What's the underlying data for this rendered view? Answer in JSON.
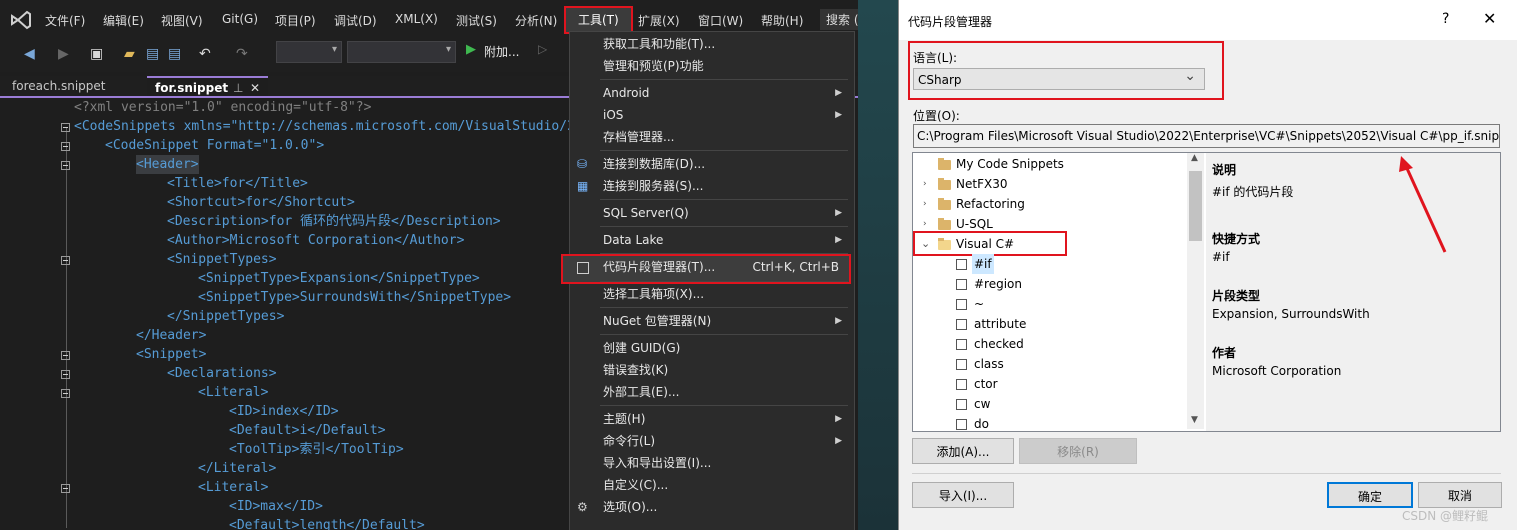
{
  "vs": {
    "menu": [
      "文件(F)",
      "编辑(E)",
      "视图(V)",
      "Git(G)",
      "项目(P)",
      "调试(D)",
      "XML(X)",
      "测试(S)",
      "分析(N)",
      "工具(T)",
      "扩展(X)",
      "窗口(W)",
      "帮助(H)",
      "搜索 ("
    ],
    "toolbar_run_label": "附加...",
    "tabs": [
      "foreach.snippet",
      "for.snippet"
    ],
    "code": [
      "<?xml version=\"1.0\" encoding=\"utf-8\"?>",
      "<CodeSnippets xmlns=\"http://schemas.microsoft.com/VisualStudio/2",
      "<CodeSnippet Format=\"1.0.0\">",
      "<Header>",
      "<Title>for</Title>",
      "<Shortcut>for</Shortcut>",
      "<Description>for 循环的代码片段</Description>",
      "<Author>Microsoft Corporation</Author>",
      "<SnippetTypes>",
      "<SnippetType>Expansion</SnippetType>",
      "<SnippetType>SurroundsWith</SnippetType>",
      "</SnippetTypes>",
      "</Header>",
      "<Snippet>",
      "<Declarations>",
      "<Literal>",
      "<ID>index</ID>",
      "<Default>i</Default>",
      "<ToolTip>索引</ToolTip>",
      "</Literal>",
      "<Literal>",
      "<ID>max</ID>",
      "<Default>length</Default>"
    ],
    "tools_menu": {
      "items": [
        {
          "label": "获取工具和功能(T)...",
          "arrow": false,
          "icon": ""
        },
        {
          "label": "管理和预览(P)功能",
          "arrow": false,
          "icon": ""
        },
        {
          "label": "Android",
          "arrow": true,
          "icon": ""
        },
        {
          "label": "iOS",
          "arrow": true,
          "icon": ""
        },
        {
          "label": "存档管理器...",
          "arrow": false,
          "icon": ""
        },
        {
          "label": "连接到数据库(D)...",
          "arrow": false,
          "icon": "database-connect-icon"
        },
        {
          "label": "连接到服务器(S)...",
          "arrow": false,
          "icon": "server-connect-icon"
        },
        {
          "label": "SQL Server(Q)",
          "arrow": true,
          "icon": ""
        },
        {
          "label": "Data Lake",
          "arrow": true,
          "icon": ""
        },
        {
          "label": "代码片段管理器(T)...",
          "arrow": false,
          "icon": "checkbox-icon",
          "shortcut": "Ctrl+K, Ctrl+B"
        },
        {
          "label": "选择工具箱项(X)...",
          "arrow": false,
          "icon": ""
        },
        {
          "label": "NuGet 包管理器(N)",
          "arrow": true,
          "icon": ""
        },
        {
          "label": "创建 GUID(G)",
          "arrow": false,
          "icon": ""
        },
        {
          "label": "错误查找(K)",
          "arrow": false,
          "icon": ""
        },
        {
          "label": "外部工具(E)...",
          "arrow": false,
          "icon": ""
        },
        {
          "label": "主题(H)",
          "arrow": true,
          "icon": ""
        },
        {
          "label": "命令行(L)",
          "arrow": true,
          "icon": ""
        },
        {
          "label": "导入和导出设置(I)...",
          "arrow": false,
          "icon": ""
        },
        {
          "label": "自定义(C)...",
          "arrow": false,
          "icon": ""
        },
        {
          "label": "选项(O)...",
          "arrow": false,
          "icon": "gear-icon"
        }
      ]
    }
  },
  "dialog": {
    "title": "代码片段管理器",
    "help": "?",
    "close": "✕",
    "language_label": "语言(L):",
    "language_value": "CSharp",
    "location_label": "位置(O):",
    "location_value": "C:\\Program Files\\Microsoft Visual Studio\\2022\\Enterprise\\VC#\\Snippets\\2052\\Visual C#\\pp_if.snippet",
    "tree_folders": [
      "My Code Snippets",
      "NetFX30",
      "Refactoring",
      "U-SQL",
      "Visual C#"
    ],
    "tree_snippets": [
      "#if",
      "#region",
      "~",
      "attribute",
      "checked",
      "class",
      "ctor",
      "cw",
      "do"
    ],
    "info": {
      "desc_h": "说明",
      "desc_v": "#if 的代码片段",
      "shortcut_h": "快捷方式",
      "shortcut_v": "#if",
      "type_h": "片段类型",
      "type_v": "Expansion, SurroundsWith",
      "author_h": "作者",
      "author_v": "Microsoft Corporation"
    },
    "buttons": {
      "add": "添加(A)...",
      "remove": "移除(R)",
      "import": "导入(I)...",
      "ok": "确定",
      "cancel": "取消"
    }
  },
  "watermark": "CSDN @鲤籽鲲"
}
